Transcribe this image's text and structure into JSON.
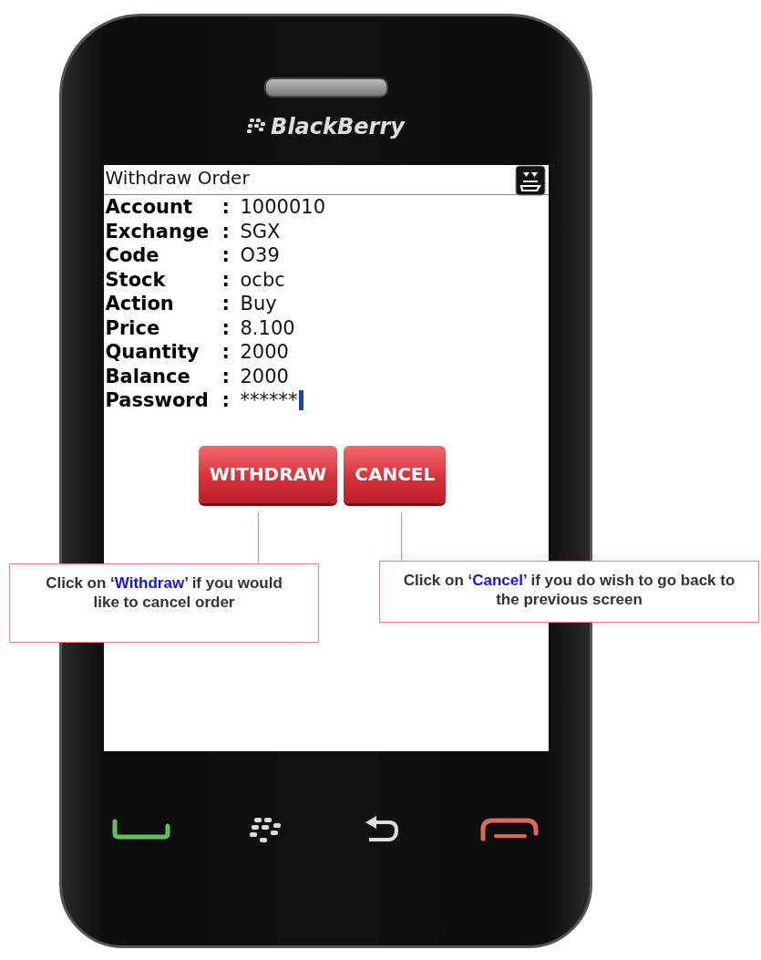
{
  "device": {
    "brand": "BlackBerry"
  },
  "screen": {
    "title": "Withdraw Order",
    "fields": [
      {
        "label": "Account",
        "separator": ":",
        "value": "1000010",
        "focused": false
      },
      {
        "label": "Exchange",
        "separator": ":",
        "value": "SGX",
        "focused": false
      },
      {
        "label": "Code",
        "separator": ":",
        "value": "O39",
        "focused": false
      },
      {
        "label": "Stock",
        "separator": ":",
        "value": "ocbc",
        "focused": false
      },
      {
        "label": "Action",
        "separator": ":",
        "value": "Buy",
        "focused": false
      },
      {
        "label": "Price",
        "separator": ":",
        "value": "8.100",
        "focused": false
      },
      {
        "label": "Quantity",
        "separator": ":",
        "value": "2000",
        "focused": false
      },
      {
        "label": "Balance",
        "separator": ":",
        "value": "2000",
        "focused": false
      },
      {
        "label": "Password",
        "separator": ":",
        "value": "******",
        "focused": true
      }
    ],
    "buttons": [
      {
        "label": "WITHDRAW"
      },
      {
        "label": "CANCEL"
      }
    ]
  },
  "callouts": [
    {
      "before": "Click on ‘",
      "highlight": "Withdraw",
      "after": "’ if you would like to cancel order"
    },
    {
      "before": "Click on ‘",
      "highlight": "Cancel",
      "after": "’ if you do wish to go back to the previous screen"
    }
  ]
}
